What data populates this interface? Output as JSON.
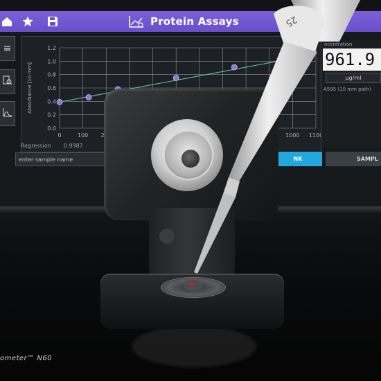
{
  "header": {
    "title": "Protein Assays",
    "icons": [
      "home-icon",
      "star-icon",
      "save-icon",
      "chart-icon"
    ]
  },
  "sidebar": {
    "buttons": [
      "menu-icon",
      "search-document-icon",
      "peak-curve-icon"
    ]
  },
  "chart": {
    "ylabel": "Absorbance [10 mm]",
    "yticks": [
      "1.2",
      "1.0",
      "0.8",
      "0.6",
      "0.4",
      "0.2",
      "0.0"
    ],
    "xticks": [
      "0",
      "100",
      "200",
      "1000",
      "1100"
    ]
  },
  "chart_data": {
    "type": "scatter",
    "x": [
      0,
      125,
      250,
      500,
      750,
      1000
    ],
    "y": [
      0.39,
      0.46,
      0.58,
      0.75,
      0.91,
      1.05
    ],
    "xlim": [
      0,
      1100
    ],
    "ylim": [
      0,
      1.2
    ],
    "ylabel": "Absorbance [10 mm]",
    "grid": true,
    "fit_line": true
  },
  "regression": {
    "label": "Regression",
    "value": "0.9987"
  },
  "sample": {
    "placeholder": "enter sample name"
  },
  "buttons": {
    "blank": "NK",
    "sample": "SAMPL"
  },
  "result": {
    "label": "ncentration",
    "value": "961.9",
    "unit": "µg/ml",
    "method": "A595 (10 mm path)"
  },
  "pipette": {
    "volume_label": "25"
  },
  "brand": {
    "text": "ometer™ N60"
  },
  "colors": {
    "header": "#6a4fcc",
    "accent": "#24a7df",
    "data_point": "#8b78d8",
    "fit_line": "#5fb8a8"
  }
}
